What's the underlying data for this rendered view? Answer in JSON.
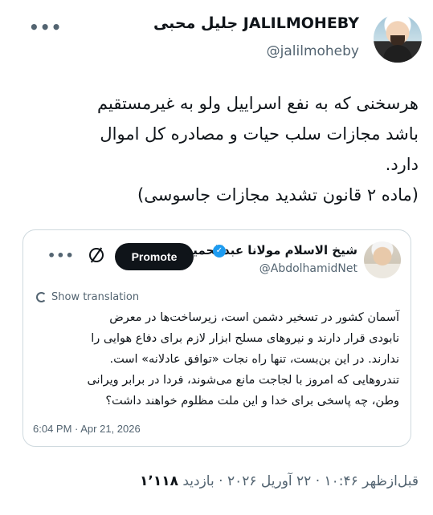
{
  "author": {
    "display_name": "JALILMOHEBY جلیل محبی",
    "handle": "@jalilmoheby",
    "avatar_icon": "profile-photo"
  },
  "tweet": {
    "lines": [
      "هرسخنی که به نفع اسراییل ولو به غیرمستقیم",
      "باشد مجازات سلب حیات و مصادره کل اموال",
      "دارد.",
      "(ماده ۲ قانون تشدید مجازات جاسوسی)"
    ]
  },
  "quoted": {
    "display_name": "شیخ الاسلام مولانا عبدالحمید",
    "handle": "@AbdolhamidNet",
    "promote_label": "Promote",
    "show_translation_label": "Show translation",
    "lines": [
      "آسمان کشور در تسخیر دشمن است، زیرساخت‌ها در معرض",
      "نابودی قرار دارند و نیروهای مسلح ابزار لازم برای دفاع هوایی را",
      "ندارند. در این بن‌بست، تنها راه نجات «توافق عادلانه» است.",
      "تندروهایی که امروز با لجاجت مانع می‌شوند، فردا در برابر ویرانی",
      "وطن، چه پاسخی برای خدا و این ملت مظلوم خواهند داشت؟"
    ],
    "timestamp": "6:04 PM · Apr 21, 2026"
  },
  "footer": {
    "meta_text": "قبل‌ازظهر ۱۰:۴۶ · ۲۲ آوریل ۲۰۲۶ · بازدید",
    "views": "۱٬۱۱۸"
  },
  "colors": {
    "text": "#0f1419",
    "muted": "#536471",
    "verified": "#1d9bf0",
    "border": "#cfd9de"
  }
}
